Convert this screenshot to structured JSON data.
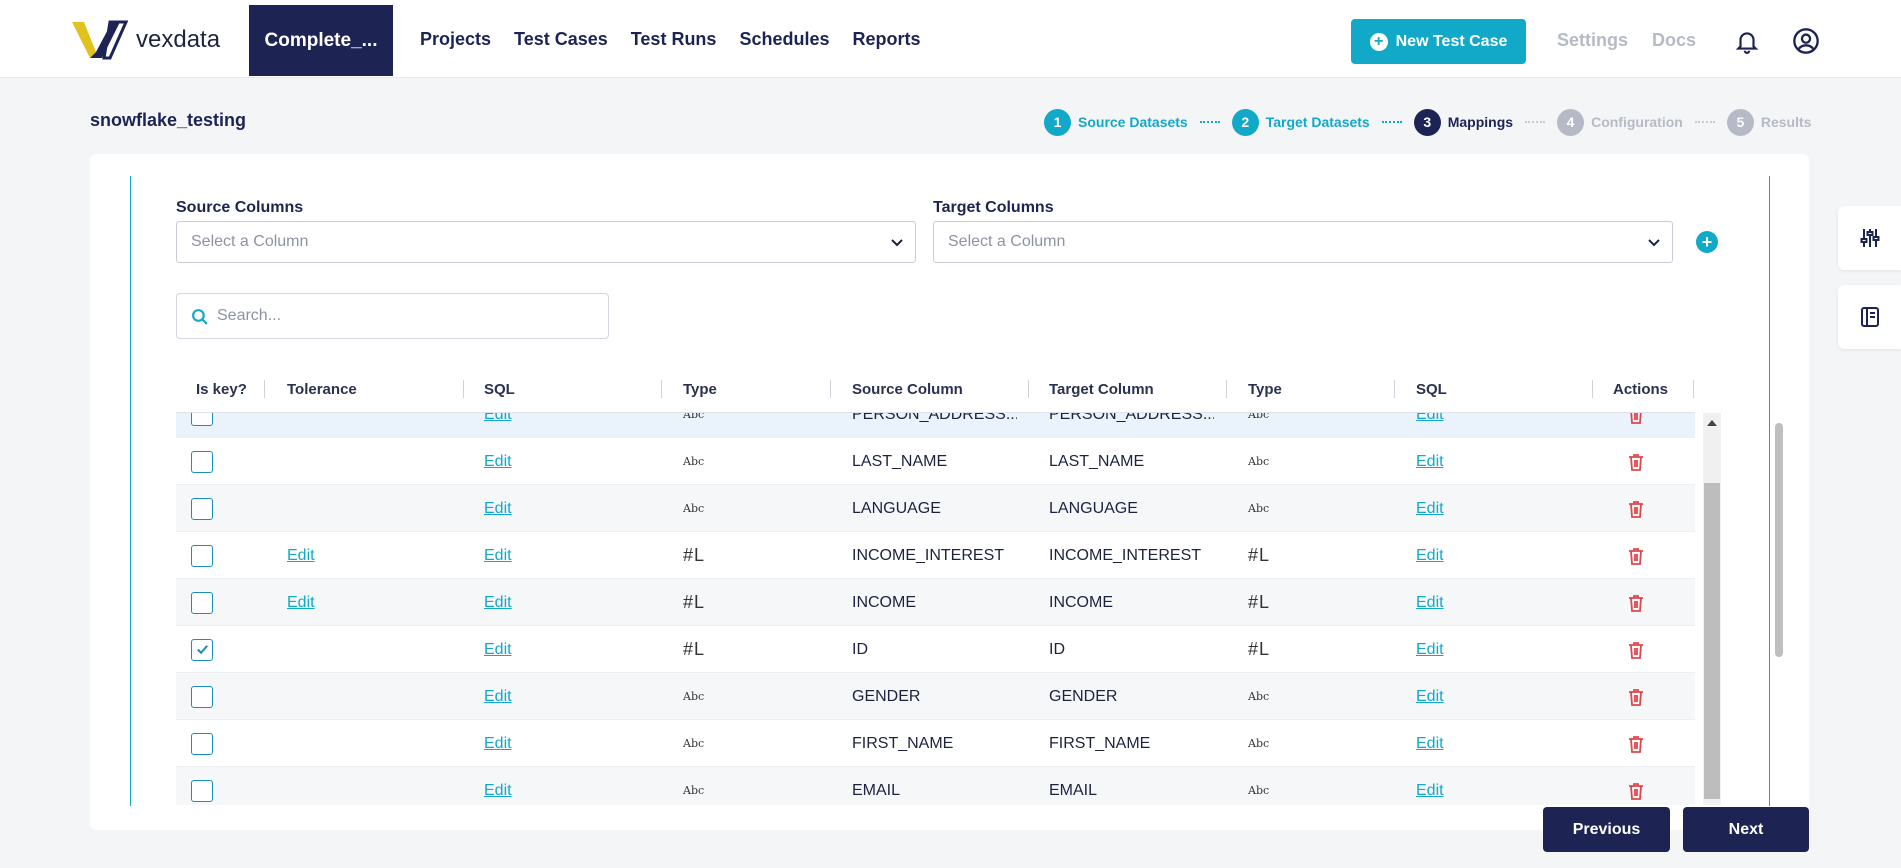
{
  "app": {
    "brand": "vexdata"
  },
  "header": {
    "project_tab": "Complete_...",
    "nav": [
      "Projects",
      "Test Cases",
      "Test Runs",
      "Schedules",
      "Reports"
    ],
    "new_test_case": "New Test Case",
    "settings": "Settings",
    "docs": "Docs"
  },
  "page": {
    "title": "snowflake_testing"
  },
  "steps": [
    {
      "num": "1",
      "label": "Source Datasets",
      "state": "done"
    },
    {
      "num": "2",
      "label": "Target Datasets",
      "state": "done"
    },
    {
      "num": "3",
      "label": "Mappings",
      "state": "active"
    },
    {
      "num": "4",
      "label": "Configuration",
      "state": "todo"
    },
    {
      "num": "5",
      "label": "Results",
      "state": "todo"
    }
  ],
  "mapping": {
    "source_label": "Source Columns",
    "source_placeholder": "Select a Column",
    "target_label": "Target Columns",
    "target_placeholder": "Select a Column",
    "search_placeholder": "Search..."
  },
  "table": {
    "headers": [
      "Is key?",
      "Tolerance",
      "SQL",
      "Type",
      "Source Column",
      "Target Column",
      "Type",
      "SQL",
      "Actions"
    ],
    "rows": [
      {
        "key": false,
        "tolerance": "",
        "sql": "Edit",
        "type": "Abc",
        "source": "PERSON_ADDRESS...",
        "target": "PERSON_ADDRESS...",
        "ttype": "Abc",
        "tsql": "Edit"
      },
      {
        "key": false,
        "tolerance": "",
        "sql": "Edit",
        "type": "Abc",
        "source": "LAST_NAME",
        "target": "LAST_NAME",
        "ttype": "Abc",
        "tsql": "Edit"
      },
      {
        "key": false,
        "tolerance": "",
        "sql": "Edit",
        "type": "Abc",
        "source": "LANGUAGE",
        "target": "LANGUAGE",
        "ttype": "Abc",
        "tsql": "Edit"
      },
      {
        "key": false,
        "tolerance": "Edit",
        "sql": "Edit",
        "type": "#L",
        "source": "INCOME_INTEREST",
        "target": "INCOME_INTEREST",
        "ttype": "#L",
        "tsql": "Edit"
      },
      {
        "key": false,
        "tolerance": "Edit",
        "sql": "Edit",
        "type": "#L",
        "source": "INCOME",
        "target": "INCOME",
        "ttype": "#L",
        "tsql": "Edit"
      },
      {
        "key": true,
        "tolerance": "",
        "sql": "Edit",
        "type": "#L",
        "source": "ID",
        "target": "ID",
        "ttype": "#L",
        "tsql": "Edit"
      },
      {
        "key": false,
        "tolerance": "",
        "sql": "Edit",
        "type": "Abc",
        "source": "GENDER",
        "target": "GENDER",
        "ttype": "Abc",
        "tsql": "Edit"
      },
      {
        "key": false,
        "tolerance": "",
        "sql": "Edit",
        "type": "Abc",
        "source": "FIRST_NAME",
        "target": "FIRST_NAME",
        "ttype": "Abc",
        "tsql": "Edit"
      },
      {
        "key": false,
        "tolerance": "",
        "sql": "Edit",
        "type": "Abc",
        "source": "EMAIL",
        "target": "EMAIL",
        "ttype": "Abc",
        "tsql": "Edit"
      }
    ]
  },
  "footer": {
    "previous": "Previous",
    "next": "Next"
  },
  "colors": {
    "primary": "#1d2453",
    "accent": "#12a9c9",
    "danger": "#e0474c"
  }
}
